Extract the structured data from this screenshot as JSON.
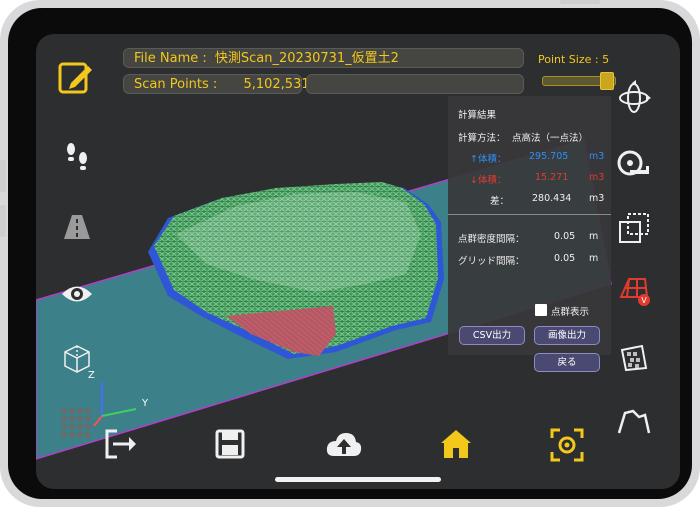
{
  "header": {
    "file_name_label": "File Name :",
    "file_name_value": "快測Scan_20230731_仮置土2",
    "scan_points_label": "Scan Points :",
    "scan_points_value": "5,102,531",
    "point_size_label": "Point Size :",
    "point_size_value": "5"
  },
  "panel": {
    "title": "計算結果",
    "method_label": "計算方法：",
    "method_value": "点高法（一点法）",
    "volume_up_label": "↑体積：",
    "volume_up_value": "295.705",
    "volume_up_unit": "m3",
    "volume_down_label": "↓体積：",
    "volume_down_value": "15.271",
    "volume_down_unit": "m3",
    "diff_label": "差：",
    "diff_value": "280.434",
    "diff_unit": "m3",
    "density_label": "点群密度間隔：",
    "density_value": "0.05",
    "density_unit": "m",
    "grid_label": "グリッド間隔：",
    "grid_value": "0.05",
    "grid_unit": "m",
    "show_points_label": "点群表示",
    "show_points_checked": false,
    "csv_button": "CSV出力",
    "image_button": "画像出力",
    "back_button": "戻る"
  },
  "axes": {
    "z": "Z",
    "y": "Y"
  },
  "colors": {
    "accent_yellow": "#f3c81c",
    "volume_up": "#2f8df5",
    "volume_down": "#e23b2e",
    "scan_green": "#3fa05a",
    "plane_cyan": "#3f8a96",
    "plane_border": "#b23ec9"
  },
  "icons": {
    "left": [
      "edit-icon",
      "footprints-icon",
      "road-icon",
      "eye-icon",
      "wireframe-cube-icon",
      "point-grid-icon"
    ],
    "right": [
      "rotate-3d-icon",
      "tape-measure-icon",
      "crop-select-icon",
      "volume-icon",
      "area-grid-icon",
      "profile-icon"
    ],
    "bottom": [
      "exit-icon",
      "save-icon",
      "cloud-upload-icon",
      "home-icon",
      "scan-focus-icon"
    ]
  }
}
